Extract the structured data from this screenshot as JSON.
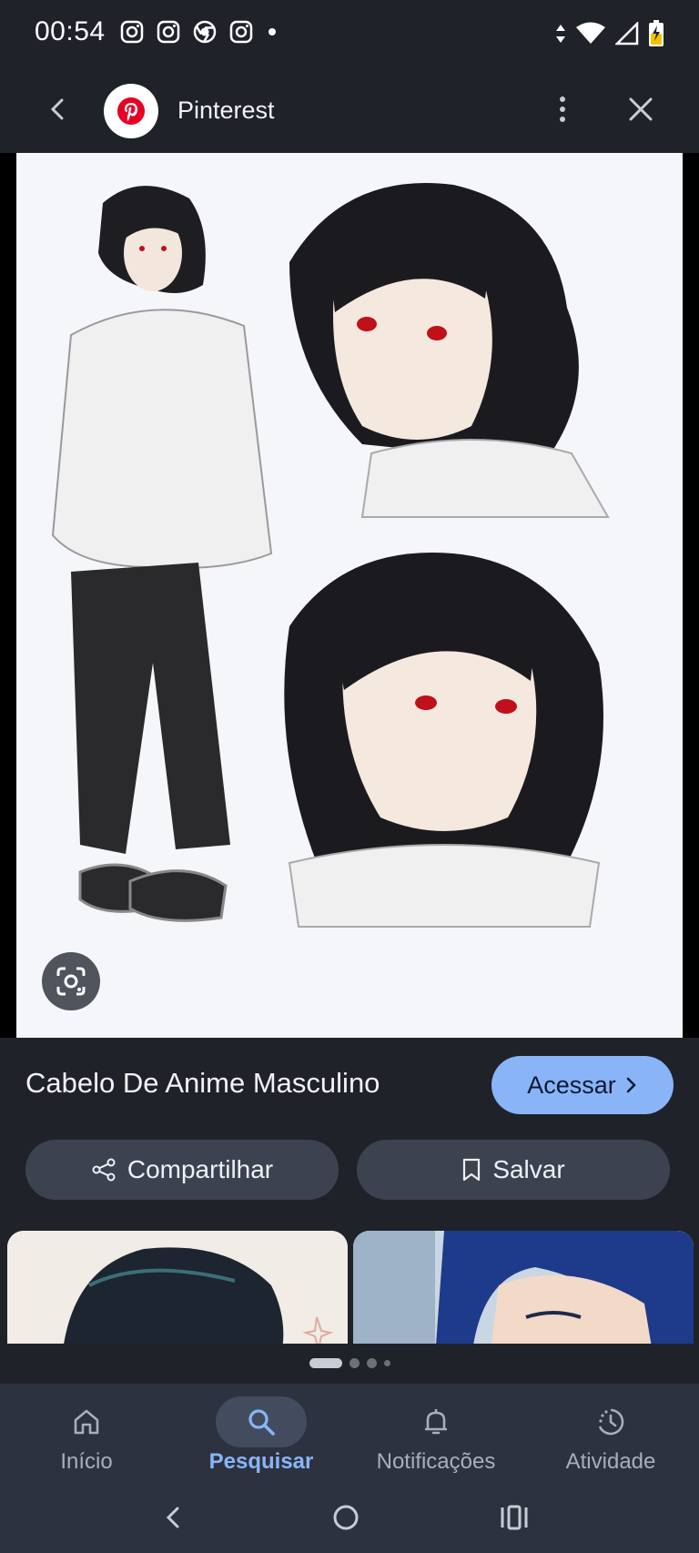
{
  "status_bar": {
    "time": "00:54",
    "notification_icons": [
      "instagram-icon",
      "instagram-icon",
      "chrome-icon",
      "instagram-icon",
      "dot-icon"
    ],
    "right_icons": [
      "data-arrows-icon",
      "wifi-icon",
      "signal-icon",
      "battery-charging-icon"
    ]
  },
  "app_bar": {
    "title": "Pinterest"
  },
  "result": {
    "title": "Cabelo De Anime Masculino",
    "visit_label": "Acessar",
    "share_label": "Compartilhar",
    "save_label": "Salvar"
  },
  "bottom_nav": {
    "items": [
      {
        "label": "Início",
        "icon": "home-icon",
        "active": false
      },
      {
        "label": "Pesquisar",
        "icon": "search-icon",
        "active": true
      },
      {
        "label": "Notificações",
        "icon": "bell-icon",
        "active": false
      },
      {
        "label": "Atividade",
        "icon": "activity-icon",
        "active": false
      }
    ]
  },
  "colors": {
    "background": "#1f2229",
    "accent": "#8ab4f8",
    "pinterest_red": "#e60023",
    "pill": "#3c4250",
    "nav": "#2c323f"
  }
}
